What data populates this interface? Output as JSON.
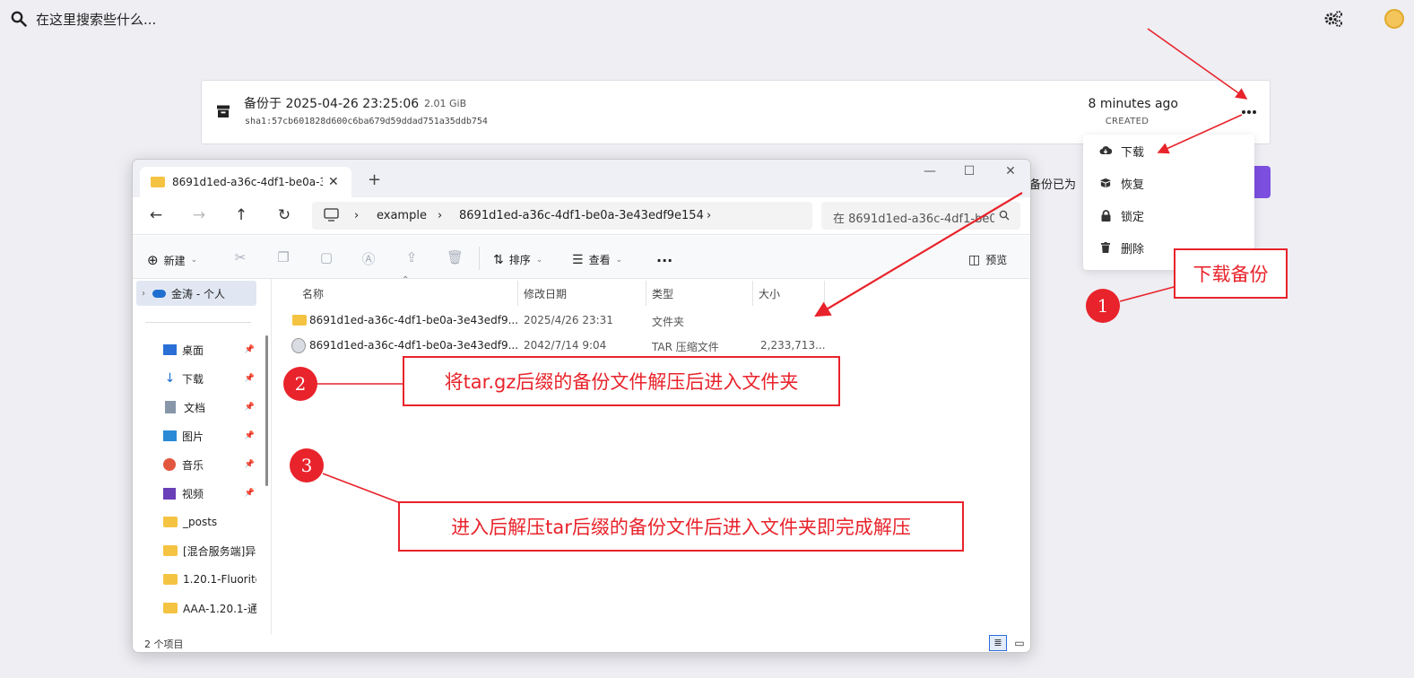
{
  "top": {
    "search_placeholder": "在这里搜索些什么..."
  },
  "backup": {
    "title": "备份于 2025-04-26 23:25:06",
    "size": "2.01 GiB",
    "sha": "sha1:57cb601828d600c6ba679d59ddad751a35ddb754",
    "time_ago": "8 minutes ago",
    "created_label": "CREATED",
    "behind_text": "备份已为"
  },
  "menu": {
    "items": [
      {
        "label": "下载",
        "icon": "cloud-download-icon"
      },
      {
        "label": "恢复",
        "icon": "restore-box-icon"
      },
      {
        "label": "锁定",
        "icon": "lock-icon"
      },
      {
        "label": "删除",
        "icon": "trash-icon"
      }
    ]
  },
  "explorer": {
    "tab_title": "8691d1ed-a36c-4df1-be0a-3e4",
    "breadcrumb": [
      "example",
      "8691d1ed-a36c-4df1-be0a-3e43edf9e154"
    ],
    "search_placeholder": "在 8691d1ed-a36c-4df1-be0a-3e43edf9e154 中搜索",
    "cmd": {
      "new": "新建",
      "sort": "排序",
      "view": "查看",
      "preview": "预览"
    },
    "sidebar": {
      "account": "金涛 - 个人",
      "items": [
        "桌面",
        "下载",
        "文档",
        "图片",
        "音乐",
        "视频",
        "_posts",
        "[混合服务端]异界",
        "1.20.1-Fluorite-",
        "AAA-1.20.1-通用"
      ]
    },
    "columns": {
      "name": "名称",
      "date": "修改日期",
      "type": "类型",
      "size": "大小"
    },
    "rows": [
      {
        "name": "8691d1ed-a36c-4df1-be0a-3e43edf9...",
        "date": "2025/4/26 23:31",
        "type": "文件夹",
        "size": ""
      },
      {
        "name": "8691d1ed-a36c-4df1-be0a-3e43edf9...",
        "date": "2042/7/14 9:04",
        "type": "TAR 压缩文件",
        "size": "2,233,713..."
      }
    ],
    "status": "2 个项目"
  },
  "annotations": {
    "step1_num": "1",
    "step1_text": "下载备份",
    "step2_num": "2",
    "step2_text": "将tar.gz后缀的备份文件解压后进入文件夹",
    "step3_num": "3",
    "step3_text": "进入后解压tar后缀的备份文件后进入文件夹即完成解压",
    "color": "#e8232b"
  }
}
